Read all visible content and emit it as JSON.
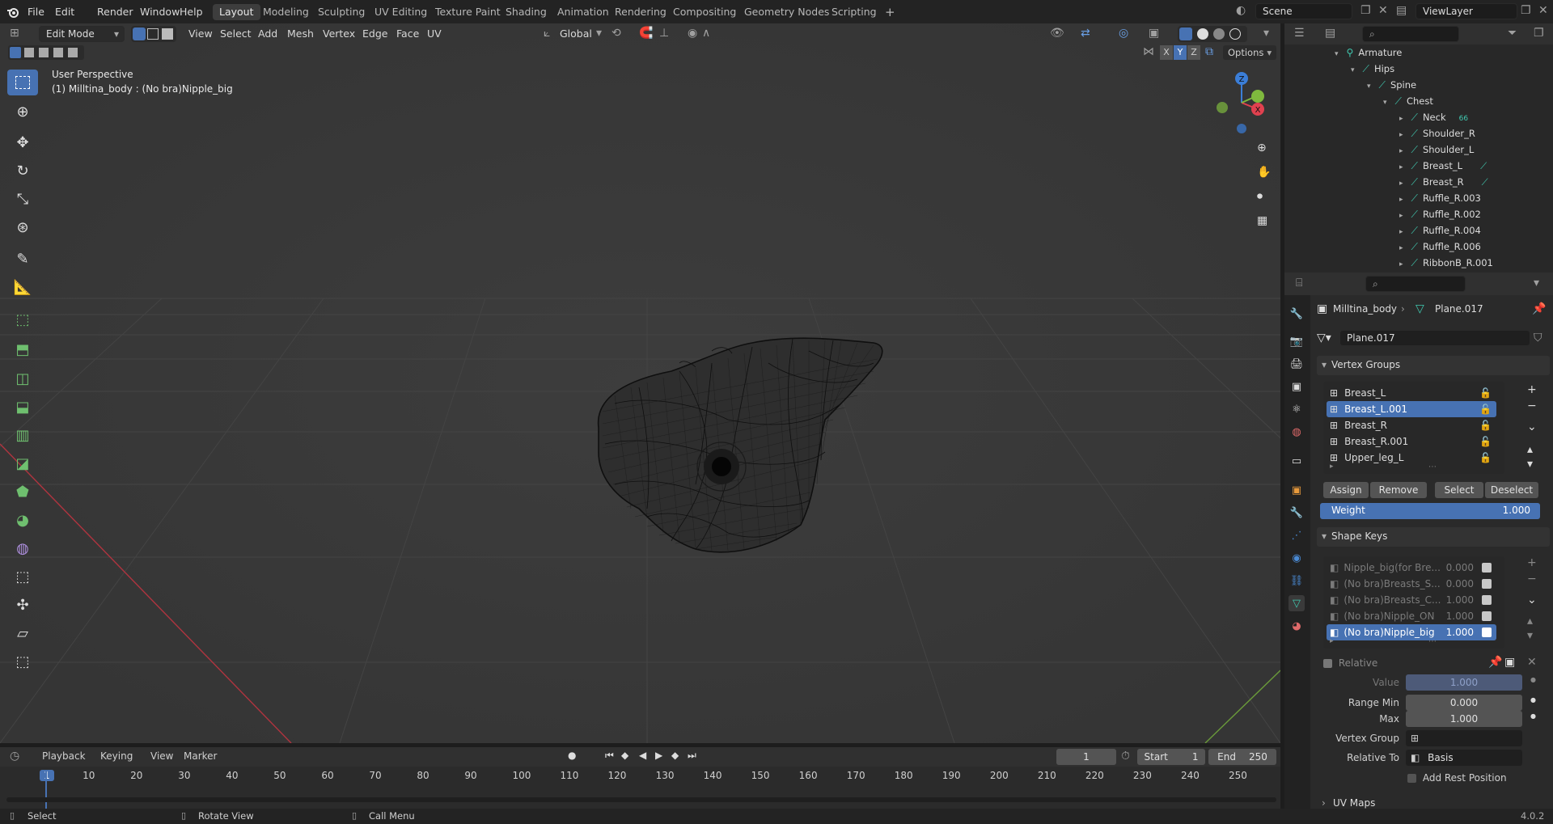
{
  "topbar": {
    "menus": [
      "File",
      "Edit",
      "Render",
      "Window",
      "Help"
    ],
    "workspaces": [
      "Layout",
      "Modeling",
      "Sculpting",
      "UV Editing",
      "Texture Paint",
      "Shading",
      "Animation",
      "Rendering",
      "Compositing",
      "Geometry Nodes",
      "Scripting"
    ],
    "add_tab": "+",
    "scene": "Scene",
    "view_layer": "ViewLayer"
  },
  "viewport_header": {
    "mode": "Edit Mode",
    "menus": [
      "View",
      "Select",
      "Add",
      "Mesh",
      "Vertex",
      "Edge",
      "Face",
      "UV"
    ],
    "orientation": "Global",
    "options": "Options",
    "axes": [
      "X",
      "Y",
      "Z"
    ]
  },
  "viewport": {
    "perspective": "User Perspective",
    "object_info": "(1) Milltina_body : (No bra)Nipple_big",
    "gizmo": {
      "z": "Z",
      "y": "Y",
      "x": "X"
    }
  },
  "outliner": {
    "items": [
      {
        "label": "Armature",
        "indent": 0
      },
      {
        "label": "Hips",
        "indent": 1
      },
      {
        "label": "Spine",
        "indent": 2
      },
      {
        "label": "Chest",
        "indent": 3
      },
      {
        "label": "Neck",
        "indent": 4,
        "extra": "66"
      },
      {
        "label": "Shoulder_R",
        "indent": 4
      },
      {
        "label": "Shoulder_L",
        "indent": 4
      },
      {
        "label": "Breast_L",
        "indent": 4
      },
      {
        "label": "Breast_R",
        "indent": 4
      },
      {
        "label": "Ruffle_R.003",
        "indent": 4
      },
      {
        "label": "Ruffle_R.002",
        "indent": 4
      },
      {
        "label": "Ruffle_R.004",
        "indent": 4
      },
      {
        "label": "Ruffle_R.006",
        "indent": 4
      },
      {
        "label": "RibbonB_R.001",
        "indent": 4
      }
    ]
  },
  "properties": {
    "breadcrumb_object": "Milltina_body",
    "breadcrumb_data": "Plane.017",
    "mesh_name": "Plane.017",
    "vertex_groups": {
      "title": "Vertex Groups",
      "items": [
        "Breast_L",
        "Breast_L.001",
        "Breast_R",
        "Breast_R.001",
        "Upper_leg_L"
      ],
      "selected_index": 1,
      "assign": "Assign",
      "remove": "Remove",
      "select": "Select",
      "deselect": "Deselect",
      "weight_label": "Weight",
      "weight_value": "1.000"
    },
    "shape_keys": {
      "title": "Shape Keys",
      "items": [
        {
          "name": "Nipple_big(for Bre...",
          "value": "0.000"
        },
        {
          "name": "(No bra)Breasts_S...",
          "value": "0.000"
        },
        {
          "name": "(No bra)Breasts_C...",
          "value": "1.000"
        },
        {
          "name": "(No bra)Nipple_ON",
          "value": "1.000"
        },
        {
          "name": "(No bra)Nipple_big",
          "value": "1.000"
        }
      ],
      "selected_index": 4,
      "relative": "Relative",
      "value_label": "Value",
      "value": "1.000",
      "range_min_label": "Range Min",
      "range_min": "0.000",
      "max_label": "Max",
      "max": "1.000",
      "vertex_group_label": "Vertex Group",
      "relative_to_label": "Relative To",
      "relative_to": "Basis",
      "add_rest": "Add Rest Position",
      "next_panel": "UV Maps"
    }
  },
  "timeline": {
    "menus": [
      "Playback",
      "Keying",
      "View",
      "Marker"
    ],
    "current_frame": "1",
    "start_label": "Start",
    "start": "1",
    "end_label": "End",
    "end": "250",
    "ticks": [
      "1",
      "10",
      "20",
      "30",
      "40",
      "50",
      "60",
      "70",
      "80",
      "90",
      "100",
      "110",
      "120",
      "130",
      "140",
      "150",
      "160",
      "170",
      "180",
      "190",
      "200",
      "210",
      "220",
      "230",
      "240",
      "250"
    ]
  },
  "statusbar": {
    "select": "Select",
    "rotate": "Rotate View",
    "call_menu": "Call Menu",
    "version": "4.0.2"
  },
  "colors": {
    "accent": "#4772b3",
    "bone": "#40c9b0",
    "x_axis": "#e0414f",
    "y_axis": "#7fb93e",
    "z_axis": "#3b7ed8"
  }
}
